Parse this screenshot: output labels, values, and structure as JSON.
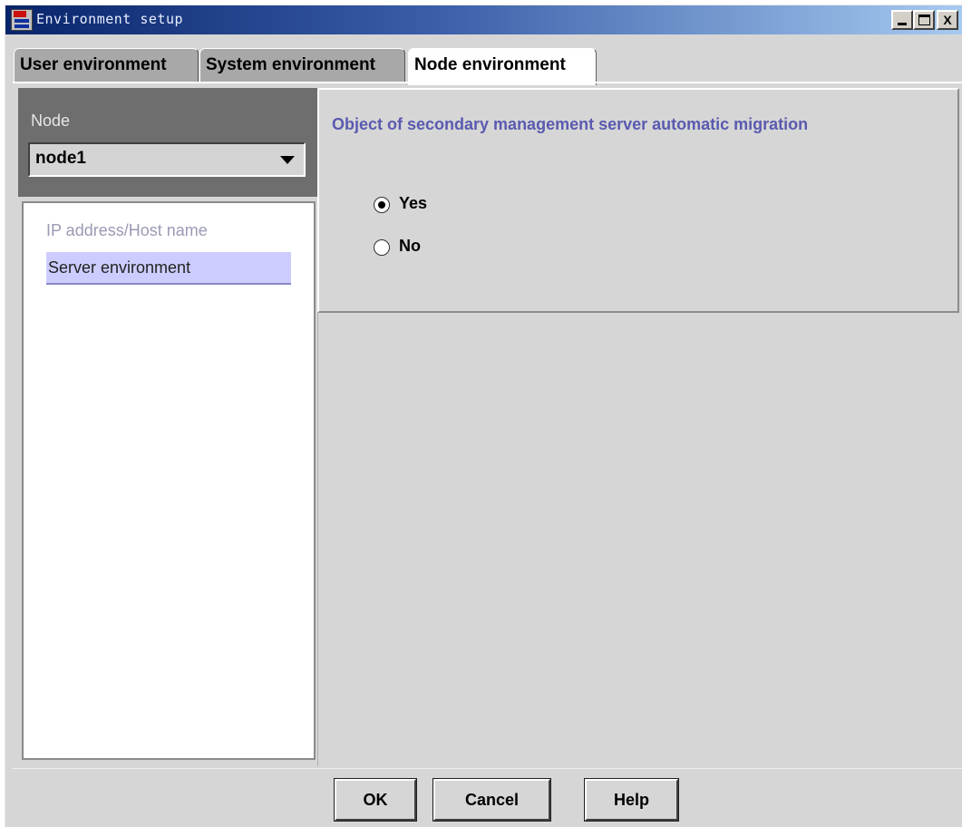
{
  "window": {
    "title": "Environment setup",
    "icon": "app-icon",
    "controls": {
      "minimize": "_",
      "maximize": "□",
      "close": "X"
    }
  },
  "tabs": [
    {
      "label": "User environment",
      "selected": false
    },
    {
      "label": "System environment",
      "selected": false
    },
    {
      "label": "Node environment",
      "selected": true
    }
  ],
  "left_panel": {
    "node_label": "Node",
    "node_select_value": "node1",
    "items": [
      {
        "label": "IP address/Host name",
        "selected": false
      },
      {
        "label": "Server environment",
        "selected": true
      }
    ]
  },
  "right_panel": {
    "group_title": "Object of secondary management server automatic migration",
    "options": [
      {
        "label": "Yes",
        "checked": true
      },
      {
        "label": "No",
        "checked": false
      }
    ]
  },
  "buttons": {
    "ok": "OK",
    "cancel": "Cancel",
    "help": "Help"
  },
  "colors": {
    "title_gradient_start": "#08246b",
    "title_gradient_end": "#a6caf0",
    "selection_bg": "#ccccff",
    "group_title": "#5a5ab0"
  }
}
